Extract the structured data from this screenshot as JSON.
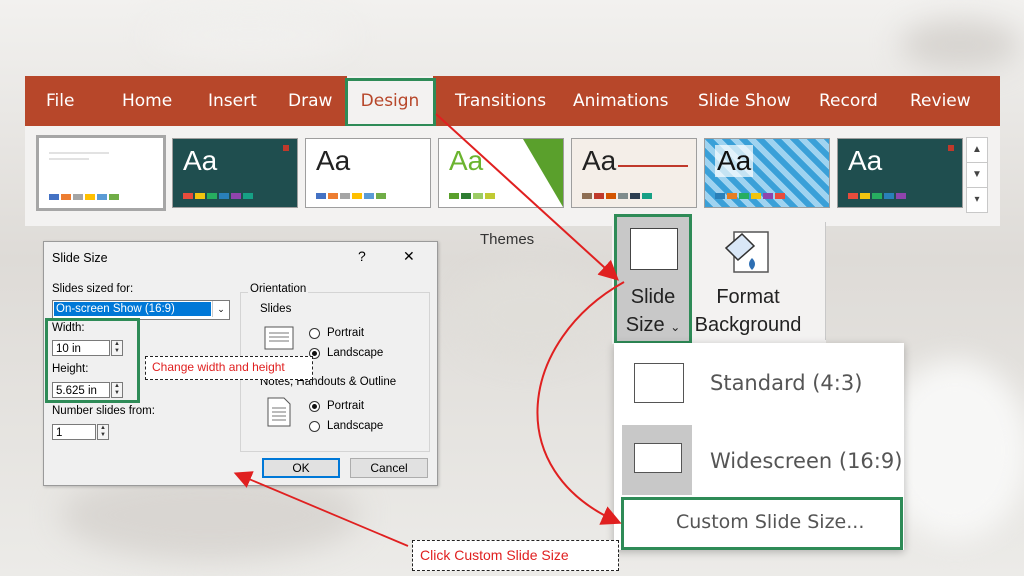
{
  "ribbon": {
    "tabs": [
      "File",
      "Home",
      "Insert",
      "Draw",
      "Design",
      "Transitions",
      "Animations",
      "Slide Show",
      "Record",
      "Review"
    ],
    "active_tab": "Design",
    "themes_label": "Themes",
    "theme_glyph": "Aa",
    "slide_size_label_1": "Slide",
    "slide_size_label_2": "Size",
    "slide_size_caret": "⌄",
    "format_background_1": "Format",
    "format_background_2": "Background"
  },
  "dropdown": {
    "standard": "Standard (4:3)",
    "widescreen": "Widescreen (16:9)",
    "custom": "Custom Slide Size..."
  },
  "dialog": {
    "title": "Slide Size",
    "help": "?",
    "close": "✕",
    "sized_for_label": "Slides sized for:",
    "sized_for_value": "On-screen Show (16:9)",
    "width_label": "Width:",
    "width_value": "10 in",
    "height_label": "Height:",
    "height_value": "5.625 in",
    "number_from_label": "Number slides from:",
    "number_from_value": "1",
    "orientation_label": "Orientation",
    "slides_label": "Slides",
    "portrait": "Portrait",
    "landscape": "Landscape",
    "notes_label": "Notes, Handouts & Outline",
    "ok": "OK",
    "cancel": "Cancel",
    "slides_orientation": "Landscape",
    "notes_orientation": "Portrait"
  },
  "annotations": {
    "change_wh": "Change width and height",
    "click_custom": "Click Custom Slide Size"
  },
  "colors": {
    "ribbon": "#b7472a",
    "highlight": "#2e8b57",
    "arrow": "#e02020",
    "selection": "#0078d7"
  }
}
